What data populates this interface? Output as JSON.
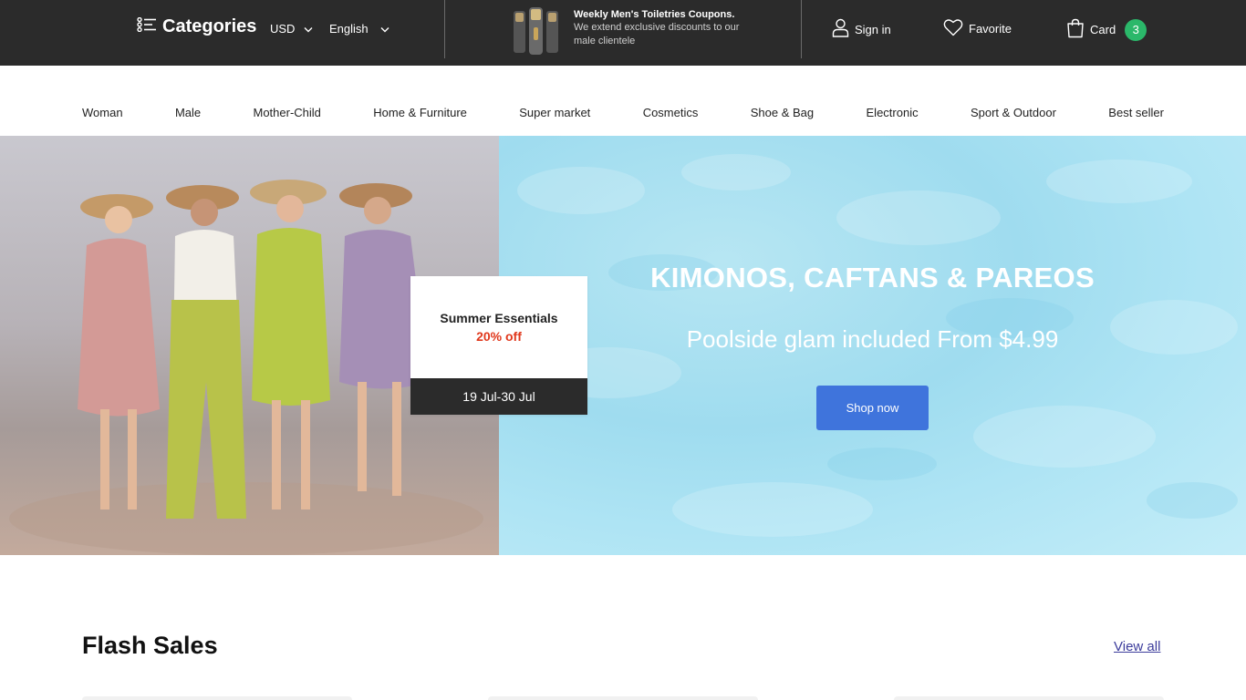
{
  "topbar": {
    "categories_label": "Categories",
    "currency": "USD",
    "language": "English",
    "promo": {
      "title": "Weekly Men's Toiletries Coupons.",
      "text": "We extend exclusive discounts to our male clientele"
    },
    "sign_in": "Sign in",
    "favorite": "Favorite",
    "card": "Card",
    "card_count": "3"
  },
  "nav": {
    "items": [
      "Woman",
      "Male",
      "Mother-Child",
      "Home & Furniture",
      "Super market",
      "Cosmetics",
      "Shoe & Bag",
      "Electronic",
      "Sport & Outdoor",
      "Best seller"
    ]
  },
  "hero": {
    "card_title": "Summer Essentials",
    "card_discount": "20% off",
    "card_dates": "19 Jul-30 Jul",
    "title": "KIMONOS, CAFTANS & PAREOS",
    "subtitle": "Poolside glam included From $4.99",
    "button": "Shop now"
  },
  "flash_sales": {
    "title": "Flash Sales",
    "view_all": "View all"
  },
  "colors": {
    "topbar_bg": "#2b2b2b",
    "badge": "#2bb86a",
    "discount": "#e0371b",
    "button": "#3f74dc",
    "hero_right_bg": "#a6dff0"
  },
  "icons": [
    "categories-icon",
    "chevron-down-icon",
    "user-icon",
    "heart-icon",
    "shopping-bag-icon"
  ]
}
